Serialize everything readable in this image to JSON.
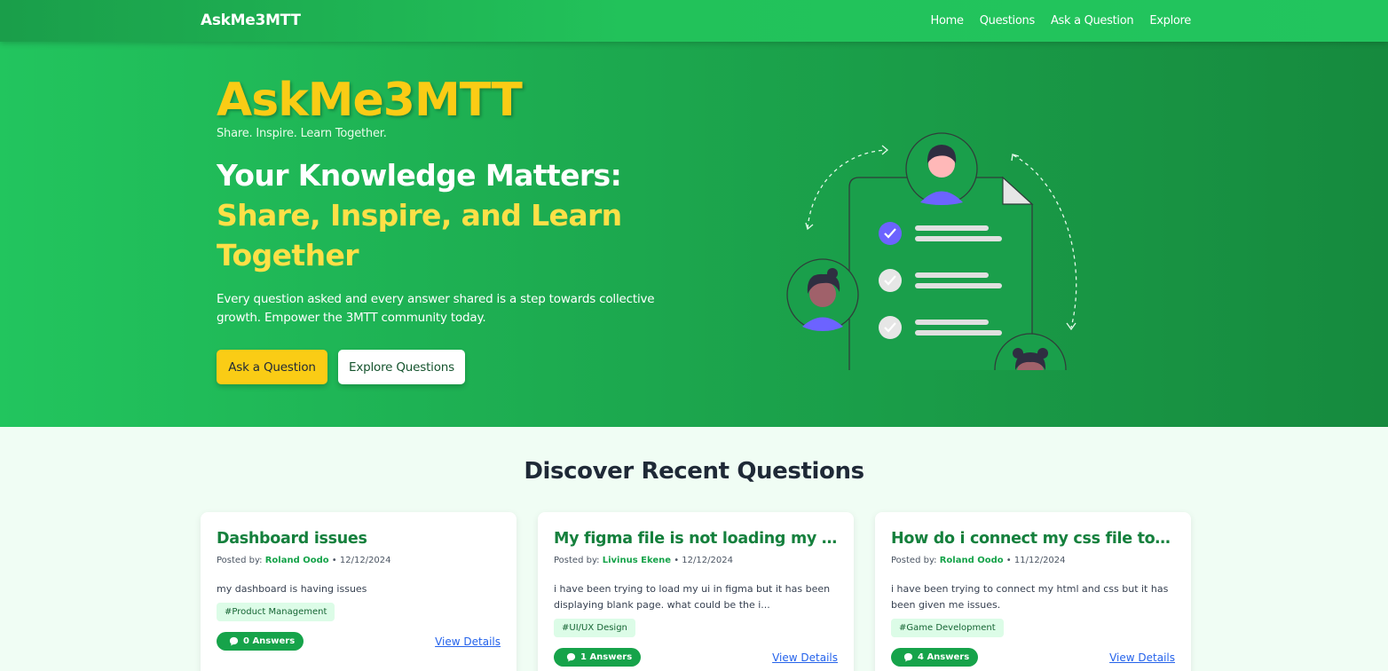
{
  "nav": {
    "brand": "AskMe3MTT",
    "links": [
      "Home",
      "Questions",
      "Ask a Question",
      "Explore"
    ]
  },
  "hero": {
    "title": "AskMe3MTT",
    "tagline": "Share. Inspire. Learn Together.",
    "heading_line1": "Your Knowledge Matters:",
    "heading_line2": "Share, Inspire, and Learn Together",
    "description": "Every question asked and every answer shared is a step towards collective growth. Empower the 3MTT community today.",
    "ask_button": "Ask a Question",
    "explore_button": "Explore Questions"
  },
  "recent": {
    "title": "Discover Recent Questions",
    "posted_by_label": "Posted by:",
    "view_details_label": "View Details",
    "questions": [
      {
        "title": "Dashboard issues",
        "author": "Roland Oodo",
        "date": "12/12/2024",
        "body": "my dashboard is having issues",
        "tag": "#Product Management",
        "answers": "0 Answers"
      },
      {
        "title": "My figma file is not loading my ui design",
        "author": "Livinus Ekene",
        "date": "12/12/2024",
        "body": "i have been trying to load my ui in figma but it has been displaying blank page. what could be the i...",
        "tag": "#UI/UX Design",
        "answers": "1 Answers"
      },
      {
        "title": "How do i connect my css file to html",
        "author": "Roland Oodo",
        "date": "11/12/2024",
        "body": "i have been trying to connect my html and css but it has been given me issues.",
        "tag": "#Game Development",
        "answers": "4 Answers"
      }
    ]
  },
  "colors": {
    "primary_green": "#22c55e",
    "dark_green": "#15803d",
    "accent_yellow": "#facc15",
    "link_blue": "#2563eb"
  }
}
